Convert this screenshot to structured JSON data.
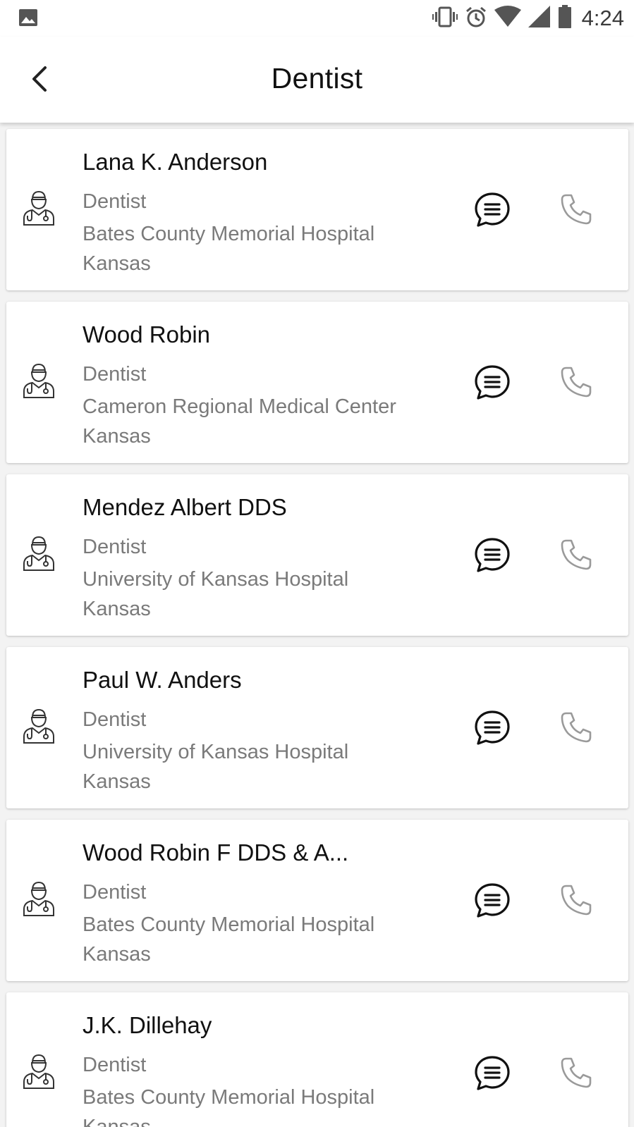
{
  "status_bar": {
    "time": "4:24",
    "icons": [
      "image-icon",
      "vibrate-icon",
      "alarm-icon",
      "wifi-icon",
      "signal-icon",
      "battery-icon"
    ]
  },
  "app_bar": {
    "title": "Dentist",
    "back_icon": "back-arrow-icon"
  },
  "colors": {
    "background": "#f3f3f3",
    "card": "#ffffff",
    "primary_text": "#111111",
    "secondary_text": "#7a7a7a",
    "call_icon": "#9a9a9a"
  },
  "dentists": [
    {
      "name": "Lana K. Anderson",
      "specialty": "Dentist",
      "hospital": "Bates County Memorial Hospital",
      "state": "Kansas"
    },
    {
      "name": "Wood Robin",
      "specialty": "Dentist",
      "hospital": "Cameron Regional Medical Center",
      "state": "Kansas"
    },
    {
      "name": "Mendez Albert DDS",
      "specialty": "Dentist",
      "hospital": "University of Kansas Hospital",
      "state": "Kansas"
    },
    {
      "name": "Paul W. Anders",
      "specialty": "Dentist",
      "hospital": "University of Kansas Hospital",
      "state": "Kansas"
    },
    {
      "name": "Wood Robin F DDS & A...",
      "specialty": "Dentist",
      "hospital": "Bates County Memorial Hospital",
      "state": "Kansas"
    },
    {
      "name": "J.K. Dillehay",
      "specialty": "Dentist",
      "hospital": "Bates County Memorial Hospital",
      "state": "Kansas"
    }
  ]
}
